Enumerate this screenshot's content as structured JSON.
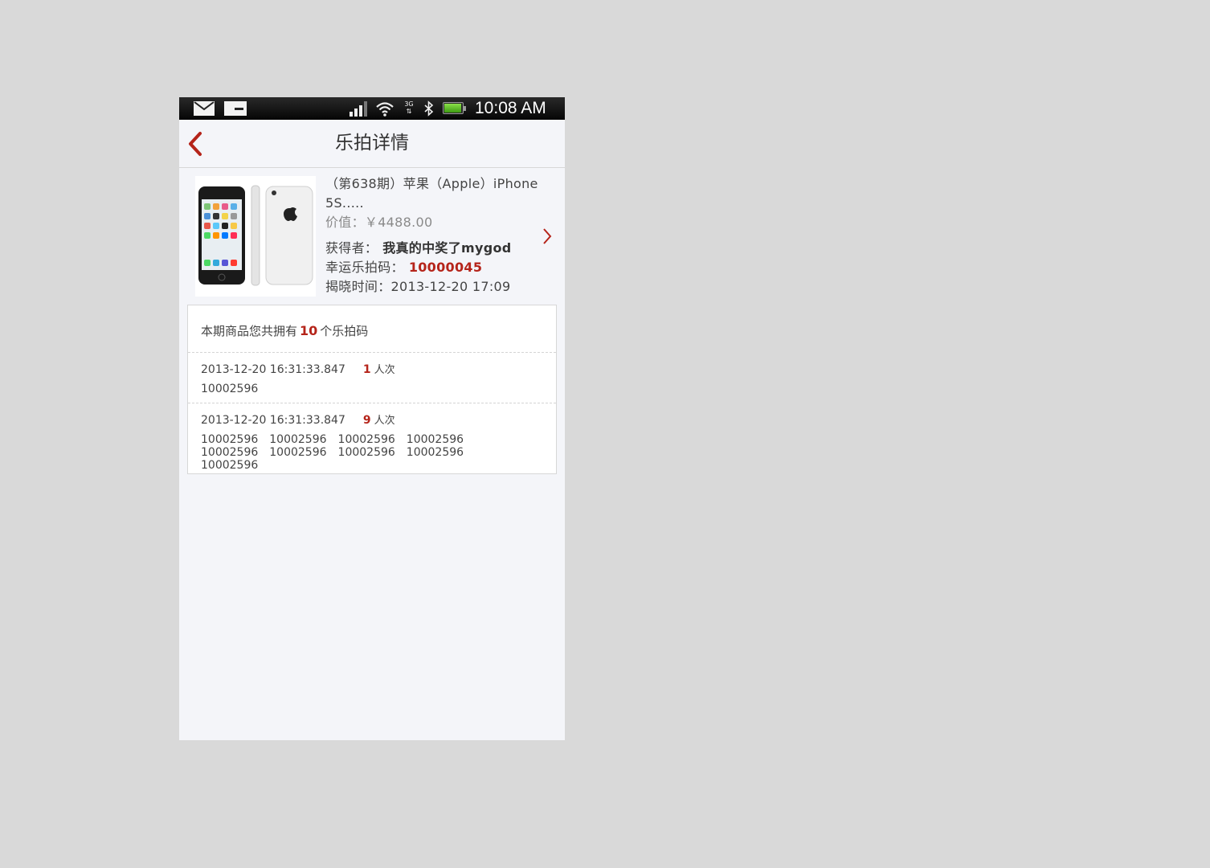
{
  "status_bar": {
    "time": "10:08 AM",
    "network": "3G",
    "icons": [
      "mail-icon",
      "message-icon",
      "signal-icon",
      "wifi-icon",
      "3g-icon",
      "bluetooth-icon",
      "battery-icon"
    ],
    "battery_level": 0.95
  },
  "header": {
    "title": "乐拍详情",
    "back_icon": "chevron-left-icon"
  },
  "product": {
    "title": "（第638期）苹果（Apple）iPhone 5S.....",
    "price_label": "价值：",
    "price": "￥4488.00",
    "winner_label": "获得者：",
    "winner_name": "我真的中奖了mygod",
    "code_label": "幸运乐拍码：",
    "lucky_code": "10000045",
    "reveal_label": "揭晓时间：",
    "reveal_time": "2013-12-20 17:09"
  },
  "codes": {
    "summary_prefix": "本期商品您共拥有",
    "count": "10",
    "summary_suffix": "个乐拍码",
    "records": [
      {
        "time": "2013-12-20 16:31:33.847",
        "count": "1",
        "unit": "人次",
        "codes": [
          "10002596"
        ]
      },
      {
        "time": "2013-12-20 16:31:33.847",
        "count": "9",
        "unit": "人次",
        "codes": [
          "10002596",
          "10002596",
          "10002596",
          "10002596",
          "10002596",
          "10002596",
          "10002596",
          "10002596",
          "10002596"
        ]
      }
    ]
  },
  "colors": {
    "accent": "#b5241a",
    "background": "#f4f5f9",
    "page_backdrop": "#d9d9d9"
  }
}
